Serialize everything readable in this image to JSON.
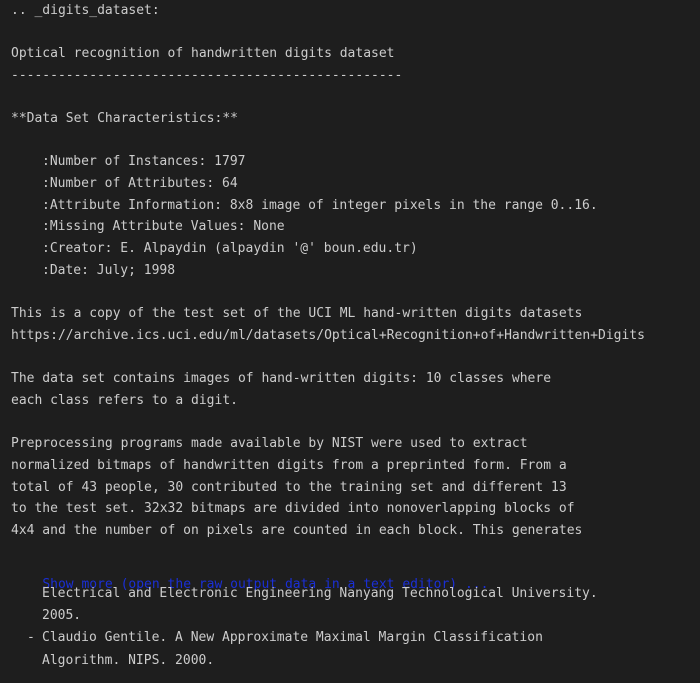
{
  "output": {
    "header_label": ".. _digits_dataset:",
    "title": "Optical recognition of handwritten digits dataset",
    "title_underline": "--------------------------------------------------",
    "characteristics_heading": "**Data Set Characteristics:**",
    "characteristics": [
      ":Number of Instances: 1797",
      ":Number of Attributes: 64",
      ":Attribute Information: 8x8 image of integer pixels in the range 0..16.",
      ":Missing Attribute Values: None",
      ":Creator: E. Alpaydin (alpaydin '@' boun.edu.tr)",
      ":Date: July; 1998"
    ],
    "copy_paragraph": [
      "This is a copy of the test set of the UCI ML hand-written digits datasets",
      "https://archive.ics.uci.edu/ml/datasets/Optical+Recognition+of+Handwritten+Digits"
    ],
    "classes_paragraph": [
      "The data set contains images of hand-written digits: 10 classes where",
      "each class refers to a digit."
    ],
    "preprocessing_paragraph": [
      "Preprocessing programs made available by NIST were used to extract",
      "normalized bitmaps of handwritten digits from a preprinted form. From a",
      "total of 43 people, 30 contributed to the training set and different 13",
      "to the test set. 32x32 bitmaps are divided into nonoverlapping blocks of",
      "4x4 and the number of on pixels are counted in each block. This generates"
    ],
    "show_more_link": "Show more (open the raw output data in a text editor) ...",
    "tail_lines": [
      "Electrical and Electronic Engineering Nanyang Technological University.",
      "2005."
    ],
    "bullet_dash": "-",
    "bullet_lines": [
      "Claudio Gentile. A New Approximate Maximal Margin Classification",
      "Algorithm. NIPS. 2000."
    ],
    "colors": {
      "background": "#1e1e1e",
      "text": "#cccccc",
      "link": "#1a2fd6"
    }
  }
}
